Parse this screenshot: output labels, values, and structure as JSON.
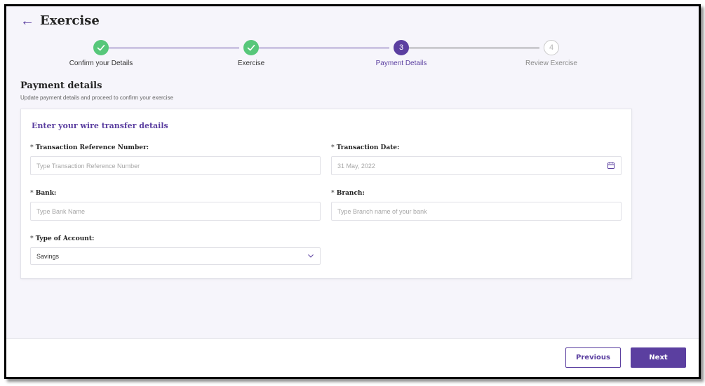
{
  "header": {
    "title": "Exercise"
  },
  "stepper": {
    "steps": [
      {
        "label": "Confirm your Details",
        "number": "1",
        "state": "done"
      },
      {
        "label": "Exercise",
        "number": "2",
        "state": "done"
      },
      {
        "label": "Payment Details",
        "number": "3",
        "state": "active"
      },
      {
        "label": "Review Exercise",
        "number": "4",
        "state": "pending"
      }
    ]
  },
  "section": {
    "title": "Payment details",
    "subtitle": "Update payment details and proceed to confirm your exercise"
  },
  "card": {
    "title": "Enter your wire transfer details",
    "required_marker": "*",
    "fields": {
      "txn_ref": {
        "label": "Transaction Reference Number:",
        "placeholder": "Type Transaction Reference Number",
        "value": ""
      },
      "txn_date": {
        "label": "Transaction Date:",
        "value": "31 May, 2022",
        "icon": "calendar-icon"
      },
      "bank": {
        "label": "Bank:",
        "placeholder": "Type Bank Name",
        "value": ""
      },
      "branch": {
        "label": "Branch:",
        "placeholder": "Type Branch name of your bank",
        "value": ""
      },
      "account_type": {
        "label": "Type of Account:",
        "value": "Savings",
        "icon": "chevron-down-icon"
      }
    }
  },
  "footer": {
    "previous_label": "Previous",
    "next_label": "Next"
  },
  "colors": {
    "accent": "#5b3fa0",
    "done": "#57c77a",
    "background": "#f6f5fb"
  }
}
